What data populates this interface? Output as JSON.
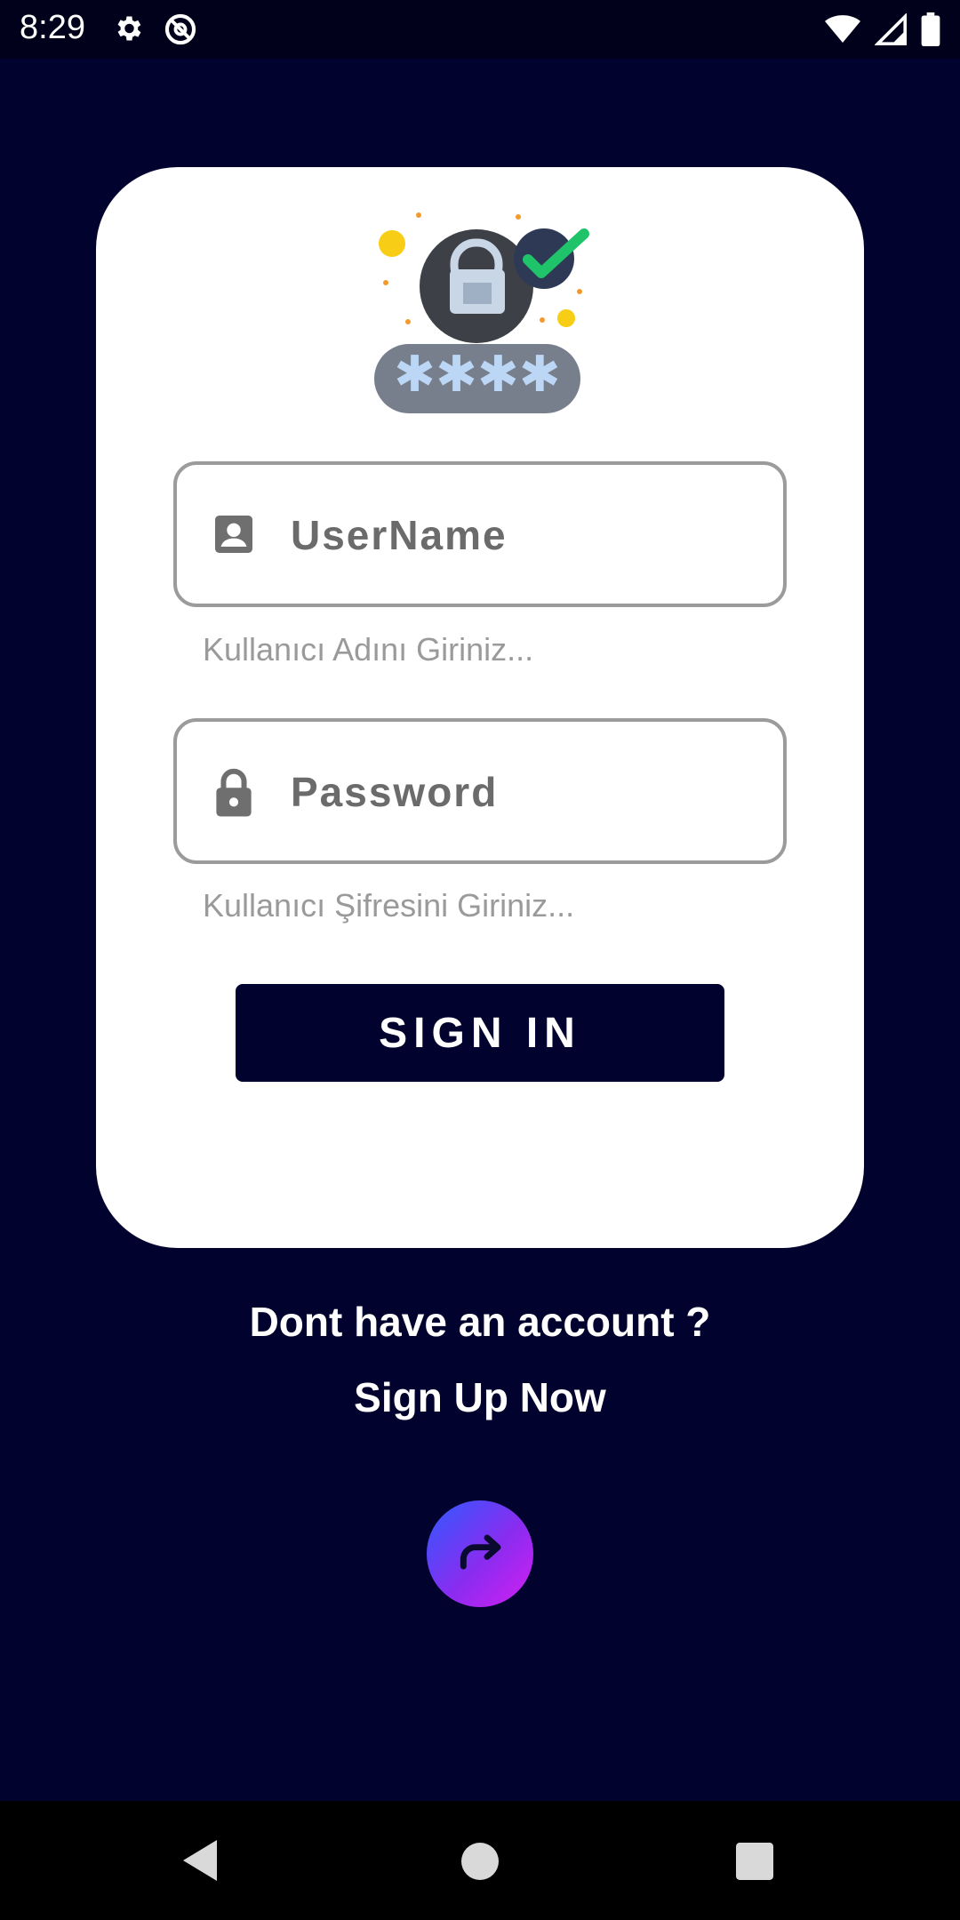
{
  "status_bar": {
    "time": "8:29",
    "icons": [
      "gear-icon",
      "at-sign-icon",
      "wifi-icon",
      "signal-icon",
      "battery-icon"
    ]
  },
  "login": {
    "hero_image": "lock-password-illustration",
    "hero_password_mask": "✱✱✱✱",
    "username": {
      "label": "UserName",
      "helper": "Kullanıcı Adını Giriniz...",
      "icon": "account-box-icon"
    },
    "password": {
      "label": "Password",
      "helper": "Kullanıcı Şifresini Giriniz...",
      "icon": "lock-icon"
    },
    "sign_in_label": "SIGN IN"
  },
  "signup": {
    "question": "Dont have an account ?",
    "link": "Sign Up Now",
    "fab_icon": "forward-arrow-icon"
  },
  "nav": {
    "icons": [
      "back-icon",
      "home-icon",
      "recents-icon"
    ]
  },
  "colors": {
    "background": "#02022e",
    "card": "#ffffff",
    "button": "#02022e",
    "fab_gradient_start": "#2d5bff",
    "fab_gradient_end": "#d41ff0"
  }
}
